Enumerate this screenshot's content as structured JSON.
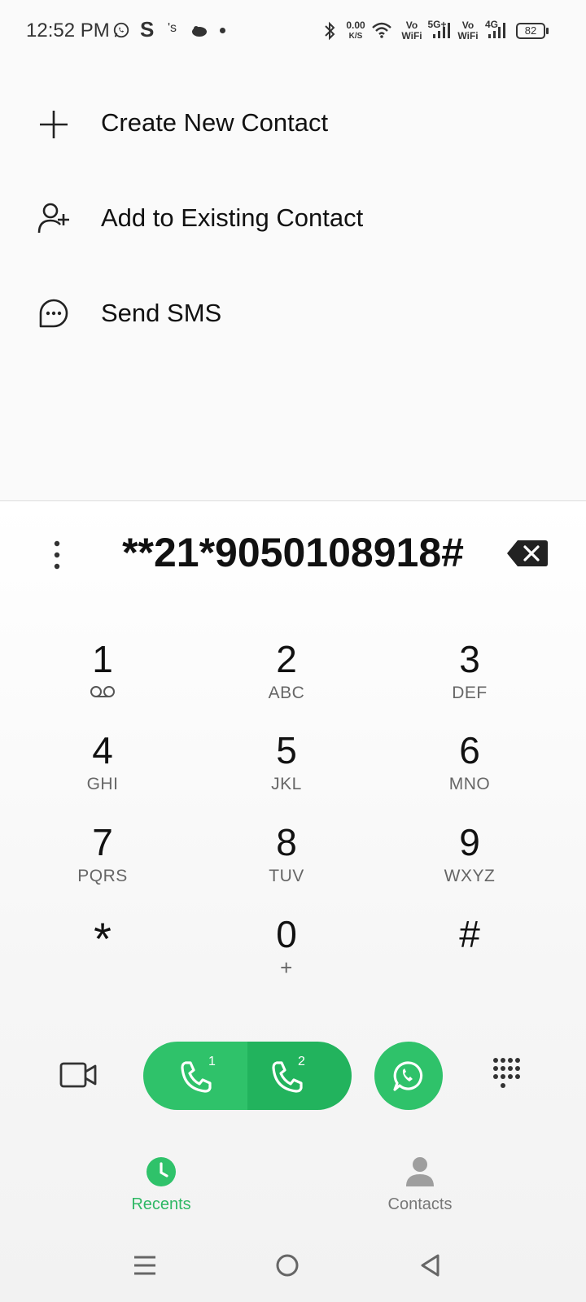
{
  "status_bar": {
    "time": "12:52 PM",
    "speed_value": "0.00",
    "speed_unit": "K/S",
    "net1_top": "Vo",
    "net1_bottom": "WiFi",
    "signal1_label": "5G+",
    "net2_top": "Vo",
    "net2_bottom": "WiFi",
    "signal2_label": "4G",
    "battery": "82"
  },
  "actions": [
    {
      "label": "Create New Contact",
      "icon": "plus-icon"
    },
    {
      "label": "Add to Existing Contact",
      "icon": "add-person-icon"
    },
    {
      "label": "Send SMS",
      "icon": "message-bubble-icon"
    }
  ],
  "dialer": {
    "number": "**21*9050108918#"
  },
  "keypad": [
    {
      "digit": "1",
      "letters": ""
    },
    {
      "digit": "2",
      "letters": "ABC"
    },
    {
      "digit": "3",
      "letters": "DEF"
    },
    {
      "digit": "4",
      "letters": "GHI"
    },
    {
      "digit": "5",
      "letters": "JKL"
    },
    {
      "digit": "6",
      "letters": "MNO"
    },
    {
      "digit": "7",
      "letters": "PQRS"
    },
    {
      "digit": "8",
      "letters": "TUV"
    },
    {
      "digit": "9",
      "letters": "WXYZ"
    },
    {
      "digit": "*",
      "letters": ""
    },
    {
      "digit": "0",
      "letters": "+"
    },
    {
      "digit": "#",
      "letters": ""
    }
  ],
  "call_buttons": {
    "sim1_badge": "1",
    "sim2_badge": "2"
  },
  "tabs": [
    {
      "label": "Recents",
      "active": true
    },
    {
      "label": "Contacts",
      "active": false
    }
  ],
  "colors": {
    "accent_green": "#2fc26a",
    "inactive_gray": "#9e9e9e"
  }
}
